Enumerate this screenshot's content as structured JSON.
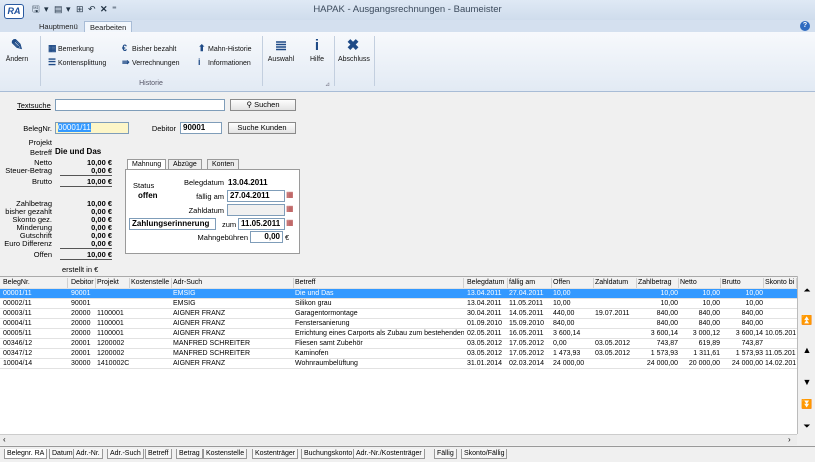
{
  "app": {
    "logo": "RA",
    "title": "HAPAK - Ausgangsrechnungen - Baumeister",
    "help_icon": "help-icon"
  },
  "ribbon_tabs": [
    "Hauptmenü",
    "Bearbeiten"
  ],
  "ribbon": {
    "aendern": "Ändern",
    "bemerkung": "Bemerkung",
    "kontensplittung": "Kontensplittung",
    "bisher_bezahlt": "Bisher bezahlt",
    "verrechnungen": "Verrechnungen",
    "mahn_historie": "Mahn-Historie",
    "informationen": "Informationen",
    "auswahl": "Auswahl",
    "hilfe": "Hilfe",
    "abschluss": "Abschluss",
    "group_label": "Historie"
  },
  "search": {
    "label": "Textsuche",
    "value": "",
    "button": "Suchen"
  },
  "header": {
    "belegnr_label": "BelegNr.",
    "belegnr": "00001/11",
    "debitor_label": "Debitor",
    "debitor": "90001",
    "suche_kunden": "Suche Kunden",
    "projekt_label": "Projekt",
    "projekt": "",
    "betreff_label": "Betreff",
    "betreff": "Die und Das"
  },
  "amounts": {
    "netto_label": "Netto",
    "netto": "10,00 €",
    "steuer_label": "Steuer-Betrag",
    "steuer": "0,00 €",
    "brutto_label": "Brutto",
    "brutto": "10,00 €",
    "zahlbetrag_label": "Zahlbetrag",
    "zahlbetrag": "10,00 €",
    "bisher_label": "bisher gezahlt",
    "bisher": "0,00 €",
    "skonto_label": "Skonto gez.",
    "skonto": "0,00 €",
    "minderung_label": "Minderung",
    "minderung": "0,00 €",
    "gutschrift_label": "Gutschrift",
    "gutschrift": "0,00 €",
    "eurodiff_label": "Euro Differenz",
    "eurodiff": "0,00 €",
    "offen_label": "Offen",
    "offen": "10,00 €",
    "erstellt": "erstellt in €"
  },
  "inner_tabs": [
    "Mahnung",
    "Abzüge",
    "Konten"
  ],
  "mahnung": {
    "status_label": "Status",
    "status": "offen",
    "belegdatum_label": "Belegdatum",
    "belegdatum": "13.04.2011",
    "faellig_label": "fällig am",
    "faellig": "27.04.2011",
    "zahldatum_label": "Zahldatum",
    "zahldatum": "",
    "stufe": "Zahlungserinnerung",
    "zum_label": "zum",
    "zum": "11.05.2011",
    "gebuehren_label": "Mahngebühren",
    "gebuehren": "0,00",
    "currency": "€"
  },
  "grid": {
    "columns": [
      "BelegNr.",
      "Debitor",
      "Projekt",
      "Kostenstelle",
      "Adr-Such",
      "Betreff",
      "Belegdatum",
      "fällig am",
      "Offen",
      "Zahldatum",
      "Zahlbetrag",
      "Netto",
      "Brutto",
      "Skonto bi"
    ],
    "rows": [
      [
        "00001/11",
        "90001",
        "",
        "",
        "EMSIG",
        "Die und Das",
        "13.04.2011",
        "27.04.2011",
        "10,00",
        "",
        "10,00",
        "10,00",
        "10,00",
        ""
      ],
      [
        "00002/11",
        "90001",
        "",
        "",
        "EMSIG",
        "Silikon grau",
        "13.04.2011",
        "11.05.2011",
        "10,00",
        "",
        "10,00",
        "10,00",
        "10,00",
        ""
      ],
      [
        "00003/11",
        "20000",
        "1100001",
        "",
        "AIGNER FRANZ",
        "Garagentormontage",
        "30.04.2011",
        "14.05.2011",
        "440,00",
        "19.07.2011",
        "840,00",
        "840,00",
        "840,00",
        ""
      ],
      [
        "00004/11",
        "20000",
        "1100001",
        "",
        "AIGNER FRANZ",
        "Fenstersanierung",
        "01.09.2010",
        "15.09.2010",
        "840,00",
        "",
        "840,00",
        "840,00",
        "840,00",
        ""
      ],
      [
        "00005/11",
        "20000",
        "1100001",
        "",
        "AIGNER FRANZ",
        "Errichtung eines Carports als Zubau zum bestehenden Wohnhaus",
        "02.05.2011",
        "16.05.2011",
        "3 600,14",
        "",
        "3 600,14",
        "3 000,12",
        "3 600,14",
        "10.05.201"
      ],
      [
        "00346/12",
        "20001",
        "1200002",
        "",
        "MANFRED SCHREITER",
        "Fliesen samt Zubehör",
        "03.05.2012",
        "17.05.2012",
        "0,00",
        "03.05.2012",
        "743,87",
        "619,89",
        "743,87",
        ""
      ],
      [
        "00347/12",
        "20001",
        "1200002",
        "",
        "MANFRED SCHREITER",
        "Kaminofen",
        "03.05.2012",
        "17.05.2012",
        "1 473,93",
        "03.05.2012",
        "1 573,93",
        "1 311,61",
        "1 573,93",
        "11.05.201"
      ],
      [
        "10004/14",
        "30000",
        "1410002C",
        "",
        "AIGNER FRANZ",
        "Wohnraumbelüftung",
        "31.01.2014",
        "02.03.2014",
        "24 000,00",
        "",
        "24 000,00",
        "20 000,00",
        "24 000,00",
        "14.02.201"
      ]
    ]
  },
  "sort_tabs": [
    "Belegnr. RA",
    "Datum",
    "Adr.-Nr.",
    "Adr.-Such",
    "Betreff",
    "Betrag",
    "Kostenstelle",
    "Kostenträger",
    "Buchungskonto",
    "Adr.-Nr./Kostenträger",
    "Fällig",
    "Skonto/Fällig"
  ]
}
